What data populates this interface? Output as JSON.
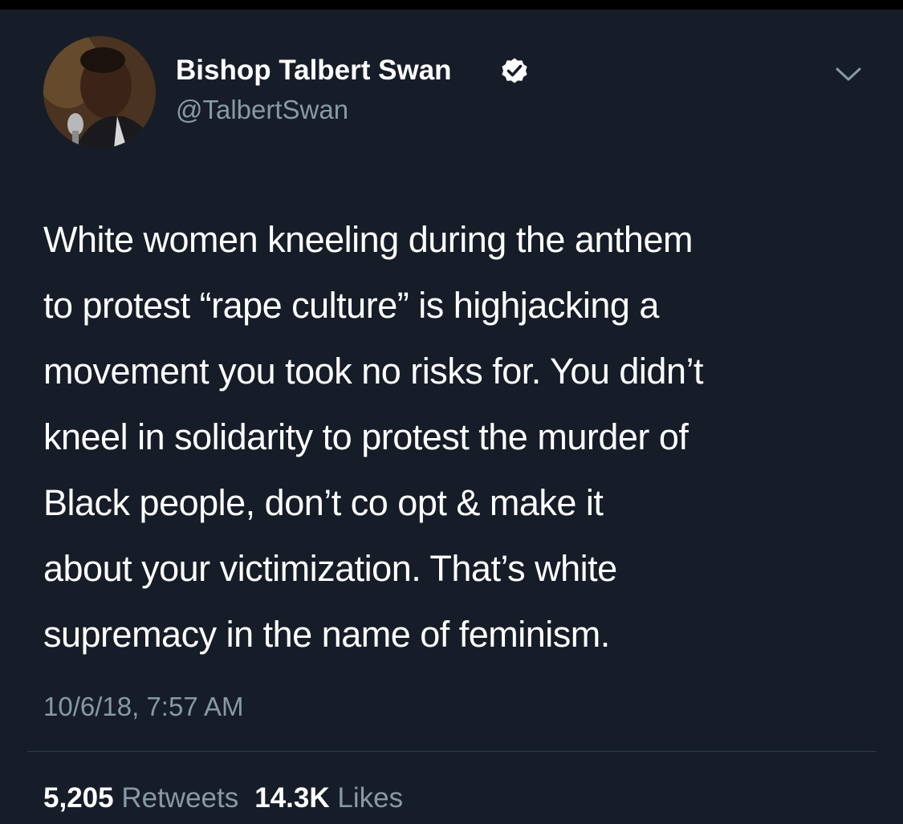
{
  "theme": {
    "background": "#161d28",
    "text": "#ffffff",
    "secondary_text": "#8899a6",
    "divider": "#2f3b49"
  },
  "tweet": {
    "author": {
      "display_name": "Bishop Talbert Swan",
      "handle": "@TalbertSwan",
      "verified": true,
      "avatar_icon": "avatar-photo"
    },
    "menu_icon": "chevron-down-icon",
    "text_lines": [
      "White women kneeling during the anthem",
      "to protest “rape culture” is highjacking a",
      "movement you took no risks for. You didn’t",
      "kneel in solidarity to protest the murder of",
      "Black people, don’t co opt & make it",
      "about your victimization. That’s white",
      "supremacy in the name of feminism."
    ],
    "timestamp": "10/6/18, 7:57 AM",
    "stats": {
      "retweets_count": "5,205",
      "retweets_label": "Retweets",
      "likes_count": "14.3K",
      "likes_label": "Likes"
    }
  }
}
